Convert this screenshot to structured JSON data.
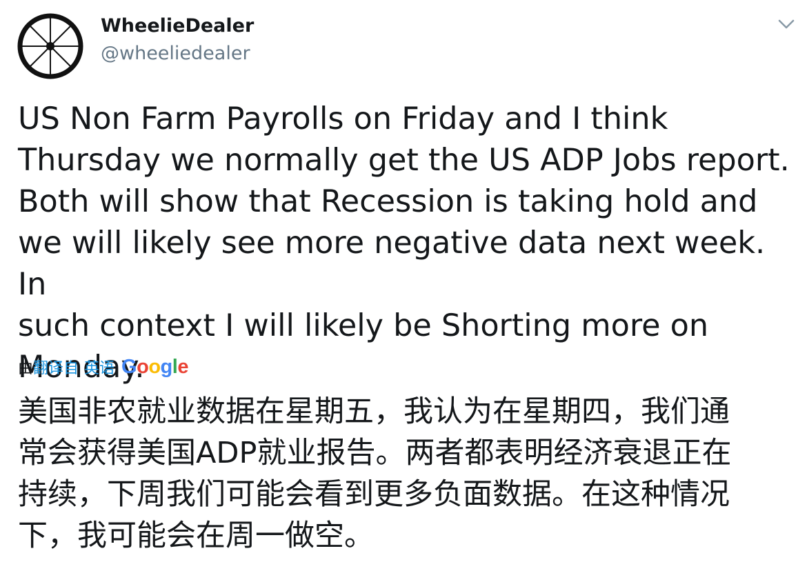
{
  "tweet": {
    "author": {
      "display_name": "WheelieDealer",
      "handle": "@wheeliedealer",
      "avatar_icon": "wheel-icon"
    },
    "menu_icon": "chevron-down-icon",
    "text": "US Non Farm Payrolls on Friday and I think\nThursday we normally get the US ADP Jobs report.\nBoth will show that Recession is taking hold and\nwe will likely see more negative data next week. In\nsuch context I will likely be Shorting more on\nMonday.",
    "translation": {
      "by_label": "由",
      "translated_from_label": "翻译自",
      "source_language": "英语",
      "provider_logo_letters": [
        "G",
        "o",
        "o",
        "g",
        "l",
        "e"
      ],
      "provider_colors": [
        "#4285f4",
        "#ea4335",
        "#fbbc05",
        "#4285f4",
        "#34a853",
        "#ea4335"
      ],
      "link_color": "#1b95e0",
      "text": "美国非农就业数据在星期五，我认为在星期四，我们通\n常会获得美国ADP就业报告。两者都表明经济衰退正在\n持续，下周我们可能会看到更多负面数据。在这种情况\n下，我可能会在周一做空。"
    }
  }
}
